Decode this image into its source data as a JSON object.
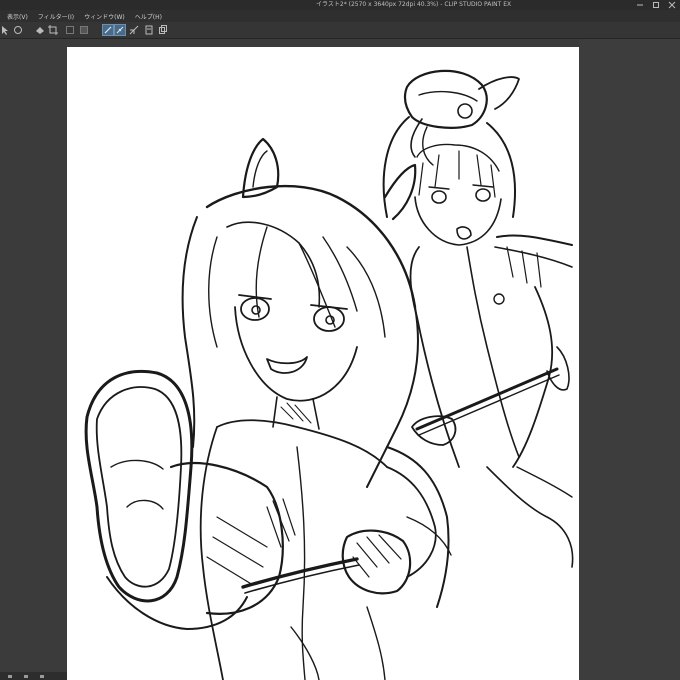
{
  "window": {
    "title": "イラスト2* (2570 x 3640px 72dpi 40.3%) - CLIP STUDIO PAINT EX"
  },
  "menu": {
    "items": [
      {
        "label": "表示(V)"
      },
      {
        "label": "フィルター(I)"
      },
      {
        "label": "ウィンドウ(W)"
      },
      {
        "label": "ヘルプ(H)"
      }
    ]
  },
  "toolbar": {
    "icons": [
      "arrow-icon",
      "lasso-icon",
      "fill-icon",
      "crop-icon",
      "clear-icon",
      "fill-selection-icon",
      "pen-active-icon",
      "ruler-active-icon",
      "snap-icon",
      "layer-icon",
      "copy-icon"
    ]
  },
  "colors": {
    "chrome": "#2b2b2b",
    "menubar": "#2f2f2f",
    "toolbar": "#353535",
    "workspace": "#3b3b3b",
    "canvas": "#ffffff",
    "active_tool": "#4a6a8a",
    "ink": "#1a1a1a"
  }
}
